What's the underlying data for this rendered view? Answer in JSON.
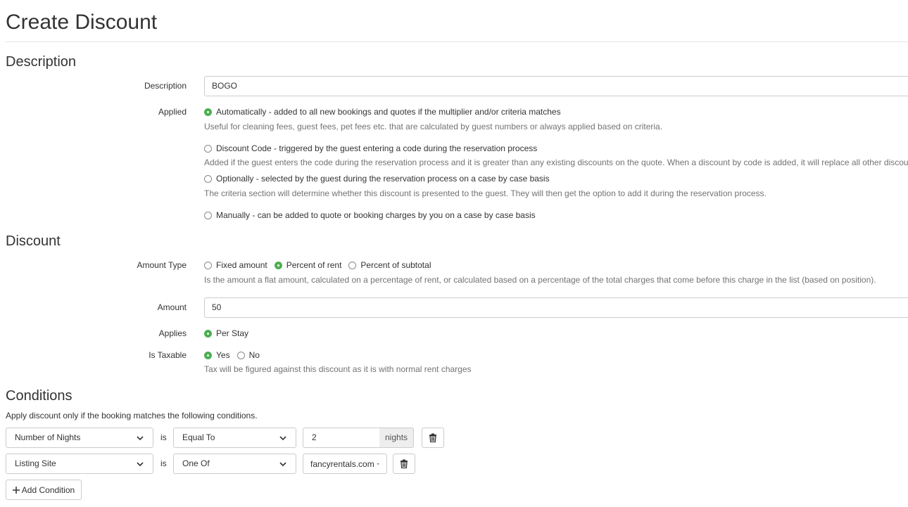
{
  "page": {
    "title": "Create Discount"
  },
  "description_section": {
    "title": "Description",
    "description_label": "Description",
    "description_value": "BOGO",
    "applied_label": "Applied",
    "applied_options": [
      {
        "label": "Automatically - added to all new bookings and quotes if the multiplier and/or criteria matches",
        "help": "Useful for cleaning fees, guest fees, pet fees etc. that are calculated by guest numbers or always applied based on criteria.",
        "checked": true
      },
      {
        "label": "Discount Code - triggered by the guest entering a code during the reservation process",
        "help": "Added if the guest enters the code during the reservation process and it is greater than any existing discounts on the quote. When a discount by code is added, it will replace all other discounts.",
        "checked": false
      },
      {
        "label": "Optionally - selected by the guest during the reservation process on a case by case basis",
        "help": "The criteria section will determine whether this discount is presented to the guest. They will then get the option to add it during the reservation process.",
        "checked": false
      },
      {
        "label": "Manually - can be added to quote or booking charges by you on a case by case basis",
        "help": "",
        "checked": false
      }
    ]
  },
  "discount_section": {
    "title": "Discount",
    "amount_type_label": "Amount Type",
    "amount_type_options": [
      {
        "label": "Fixed amount",
        "checked": false
      },
      {
        "label": "Percent of rent",
        "checked": true
      },
      {
        "label": "Percent of subtotal",
        "checked": false
      }
    ],
    "amount_type_help": "Is the amount a flat amount, calculated on a percentage of rent, or calculated based on a percentage of the total charges that come before this charge in the list (based on position).",
    "amount_label": "Amount",
    "amount_value": "50",
    "applies_label": "Applies",
    "applies_option": "Per Stay",
    "taxable_label": "Is Taxable",
    "taxable_yes": "Yes",
    "taxable_no": "No",
    "taxable_help": "Tax will be figured against this discount as it is with normal rent charges"
  },
  "conditions_section": {
    "title": "Conditions",
    "intro": "Apply discount only if the booking matches the following conditions.",
    "rows": [
      {
        "field": "Number of Nights",
        "is": "is",
        "operator": "Equal To",
        "value": "2",
        "unit": "nights"
      },
      {
        "field": "Listing Site",
        "is": "is",
        "operator": "One Of",
        "value": "fancyrentals.com"
      }
    ],
    "add_button": "Add Condition"
  },
  "colors": {
    "accent_green": "#4caf50",
    "border": "#cccccc",
    "help_text": "#737373"
  },
  "icons": {
    "delete": "trash-icon",
    "select": "chevron-down-icon",
    "add": "plus-icon",
    "dropdown": "caret-down-icon"
  }
}
